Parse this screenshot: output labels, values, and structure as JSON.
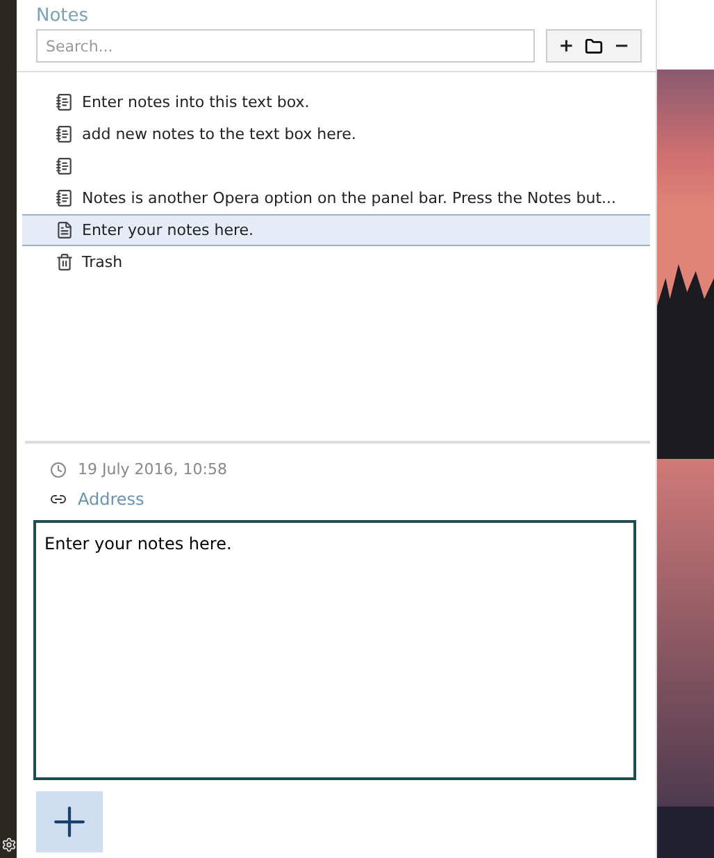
{
  "panel": {
    "title": "Notes"
  },
  "search": {
    "placeholder": "Search..."
  },
  "toolbar": [
    "+",
    "−"
  ],
  "notes": [
    {
      "kind": "note",
      "label": "Enter notes into this text box.",
      "selected": false
    },
    {
      "kind": "note",
      "label": "add new notes to the text box here.",
      "selected": false
    },
    {
      "kind": "note",
      "selected": false
    },
    {
      "kind": "note",
      "label": "Notes is another Opera option on the panel bar. Press the Notes but...",
      "selected": false
    },
    {
      "kind": "page",
      "label": "Enter your notes here.",
      "selected": true
    },
    {
      "kind": "trash",
      "label": "Trash",
      "selected": false
    }
  ],
  "detail": {
    "date": "19 July 2016, 10:58",
    "address": "Address",
    "text": "Enter your notes here."
  }
}
